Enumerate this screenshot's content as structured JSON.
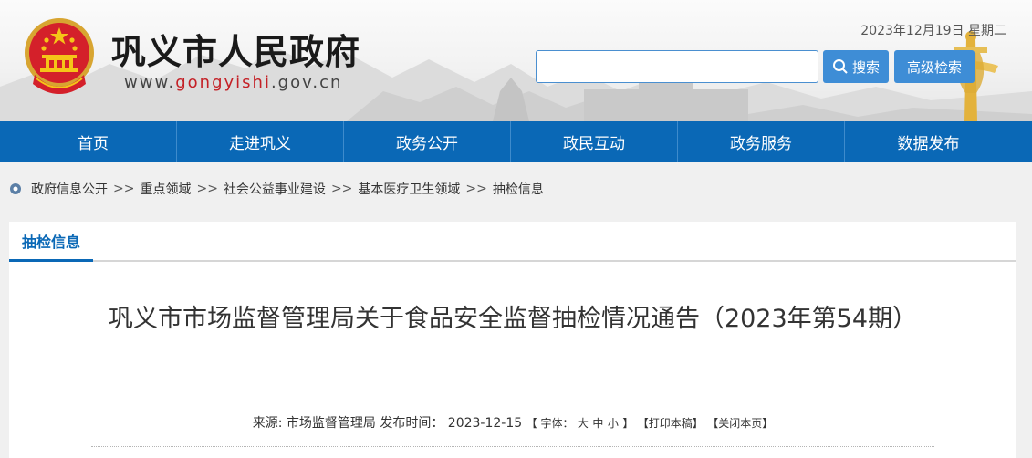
{
  "header": {
    "site_title": "巩义市人民政府",
    "site_url_prefix": "www.",
    "site_url_accent": "gongyishi",
    "site_url_suffix": ".gov.cn",
    "date": "2023年12月19日 星期二",
    "search_placeholder": "",
    "search_label": "搜索",
    "advanced_search_label": "高级检索",
    "emblem_icon": "national-emblem-icon"
  },
  "nav": {
    "items": [
      {
        "label": "首页"
      },
      {
        "label": "走进巩义"
      },
      {
        "label": "政务公开"
      },
      {
        "label": "政民互动"
      },
      {
        "label": "政务服务"
      },
      {
        "label": "数据发布"
      }
    ],
    "color": "#0a68b6"
  },
  "breadcrumb": {
    "items": [
      "政府信息公开",
      "重点领域",
      "社会公益事业建设",
      "基本医疗卫生领域",
      "抽检信息"
    ],
    "separator": ">>"
  },
  "panel": {
    "tab_label": "抽检信息"
  },
  "article": {
    "title": "巩义市市场监督管理局关于食品安全监督抽检情况通告（2023年第54期）",
    "source_label": "来源:",
    "source": "市场监督管理局",
    "published_label": "发布时间：",
    "published": "2023-12-15",
    "font_label": "【 字体：",
    "font_large": "大",
    "font_medium": "中",
    "font_small": "小",
    "font_close": "】",
    "print_label": "【打印本稿】",
    "close_label": "【关闭本页】"
  }
}
